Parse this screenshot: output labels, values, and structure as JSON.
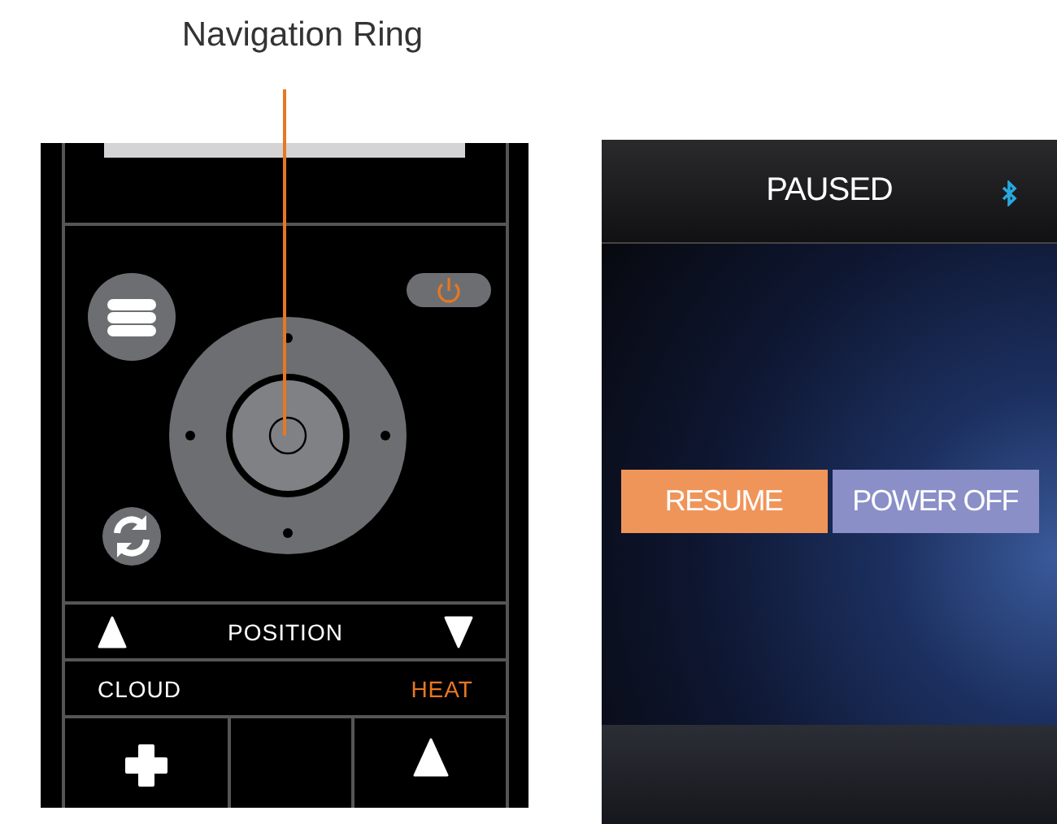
{
  "callout": {
    "label": "Navigation Ring"
  },
  "remote": {
    "position_label": "POSITION",
    "modes": [
      {
        "label": "CLOUD",
        "active": false
      },
      {
        "label": "HEAT",
        "active": true
      }
    ]
  },
  "screen": {
    "title": "PAUSED",
    "buttons": [
      {
        "label": "RESUME",
        "color": "#f0955a"
      },
      {
        "label": "POWER OFF",
        "color": "#8a8fc8"
      }
    ]
  }
}
